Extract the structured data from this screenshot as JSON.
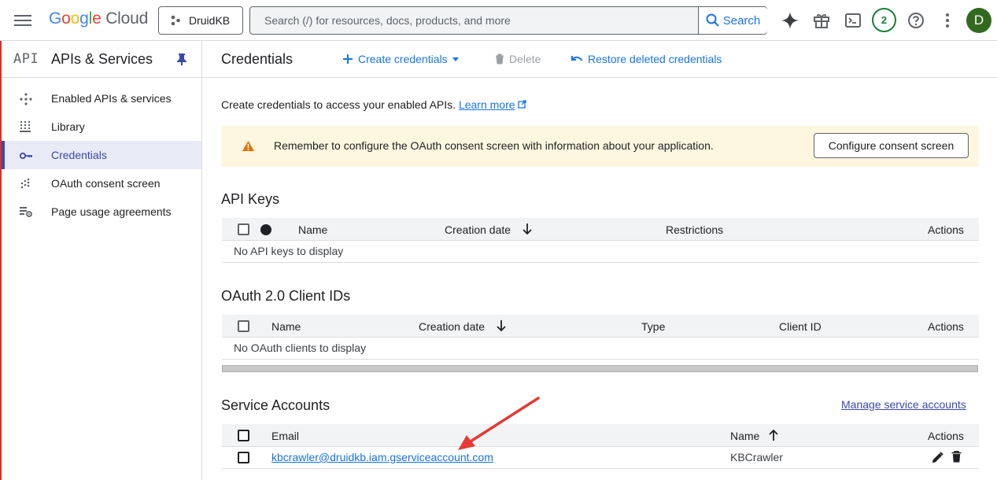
{
  "topbar": {
    "logo_google": [
      "G",
      "o",
      "o",
      "g",
      "l",
      "e"
    ],
    "logo_cloud": "Cloud",
    "project": "DruidKB",
    "search_placeholder": "Search (/) for resources, docs, products, and more",
    "search_label": "Search",
    "notification_count": "2",
    "avatar_initial": "D"
  },
  "sidebar": {
    "mark": "API",
    "title": "APIs & Services",
    "items": [
      {
        "label": "Enabled APIs & services",
        "icon": "apis-diamond-icon"
      },
      {
        "label": "Library",
        "icon": "library-grid-icon"
      },
      {
        "label": "Credentials",
        "icon": "key-icon",
        "active": true
      },
      {
        "label": "OAuth consent screen",
        "icon": "dots-grid-icon"
      },
      {
        "label": "Page usage agreements",
        "icon": "settings-list-icon"
      }
    ]
  },
  "header": {
    "title": "Credentials",
    "create_label": "Create credentials",
    "delete_label": "Delete",
    "restore_label": "Restore deleted credentials"
  },
  "intro": {
    "text": "Create credentials to access your enabled APIs.",
    "link": "Learn more"
  },
  "banner": {
    "message": "Remember to configure the OAuth consent screen with information about your application.",
    "button": "Configure consent screen"
  },
  "api_keys": {
    "title": "API Keys",
    "columns": [
      "Name",
      "Creation date",
      "Restrictions",
      "Actions"
    ],
    "empty": "No API keys to display"
  },
  "oauth": {
    "title": "OAuth 2.0 Client IDs",
    "columns": [
      "Name",
      "Creation date",
      "Type",
      "Client ID",
      "Actions"
    ],
    "empty": "No OAuth clients to display"
  },
  "service_accounts": {
    "title": "Service Accounts",
    "manage_link": "Manage service accounts",
    "columns": [
      "Email",
      "Name",
      "Actions"
    ],
    "rows": [
      {
        "email": "kbcrawler@druidkb.iam.gserviceaccount.com",
        "name": "KBCrawler"
      }
    ]
  },
  "colors": {
    "accent": "#1a73e8",
    "sidebar_active": "#3949ab",
    "banner_bg": "#fef7e0",
    "annotation_arrow": "#e53935"
  }
}
